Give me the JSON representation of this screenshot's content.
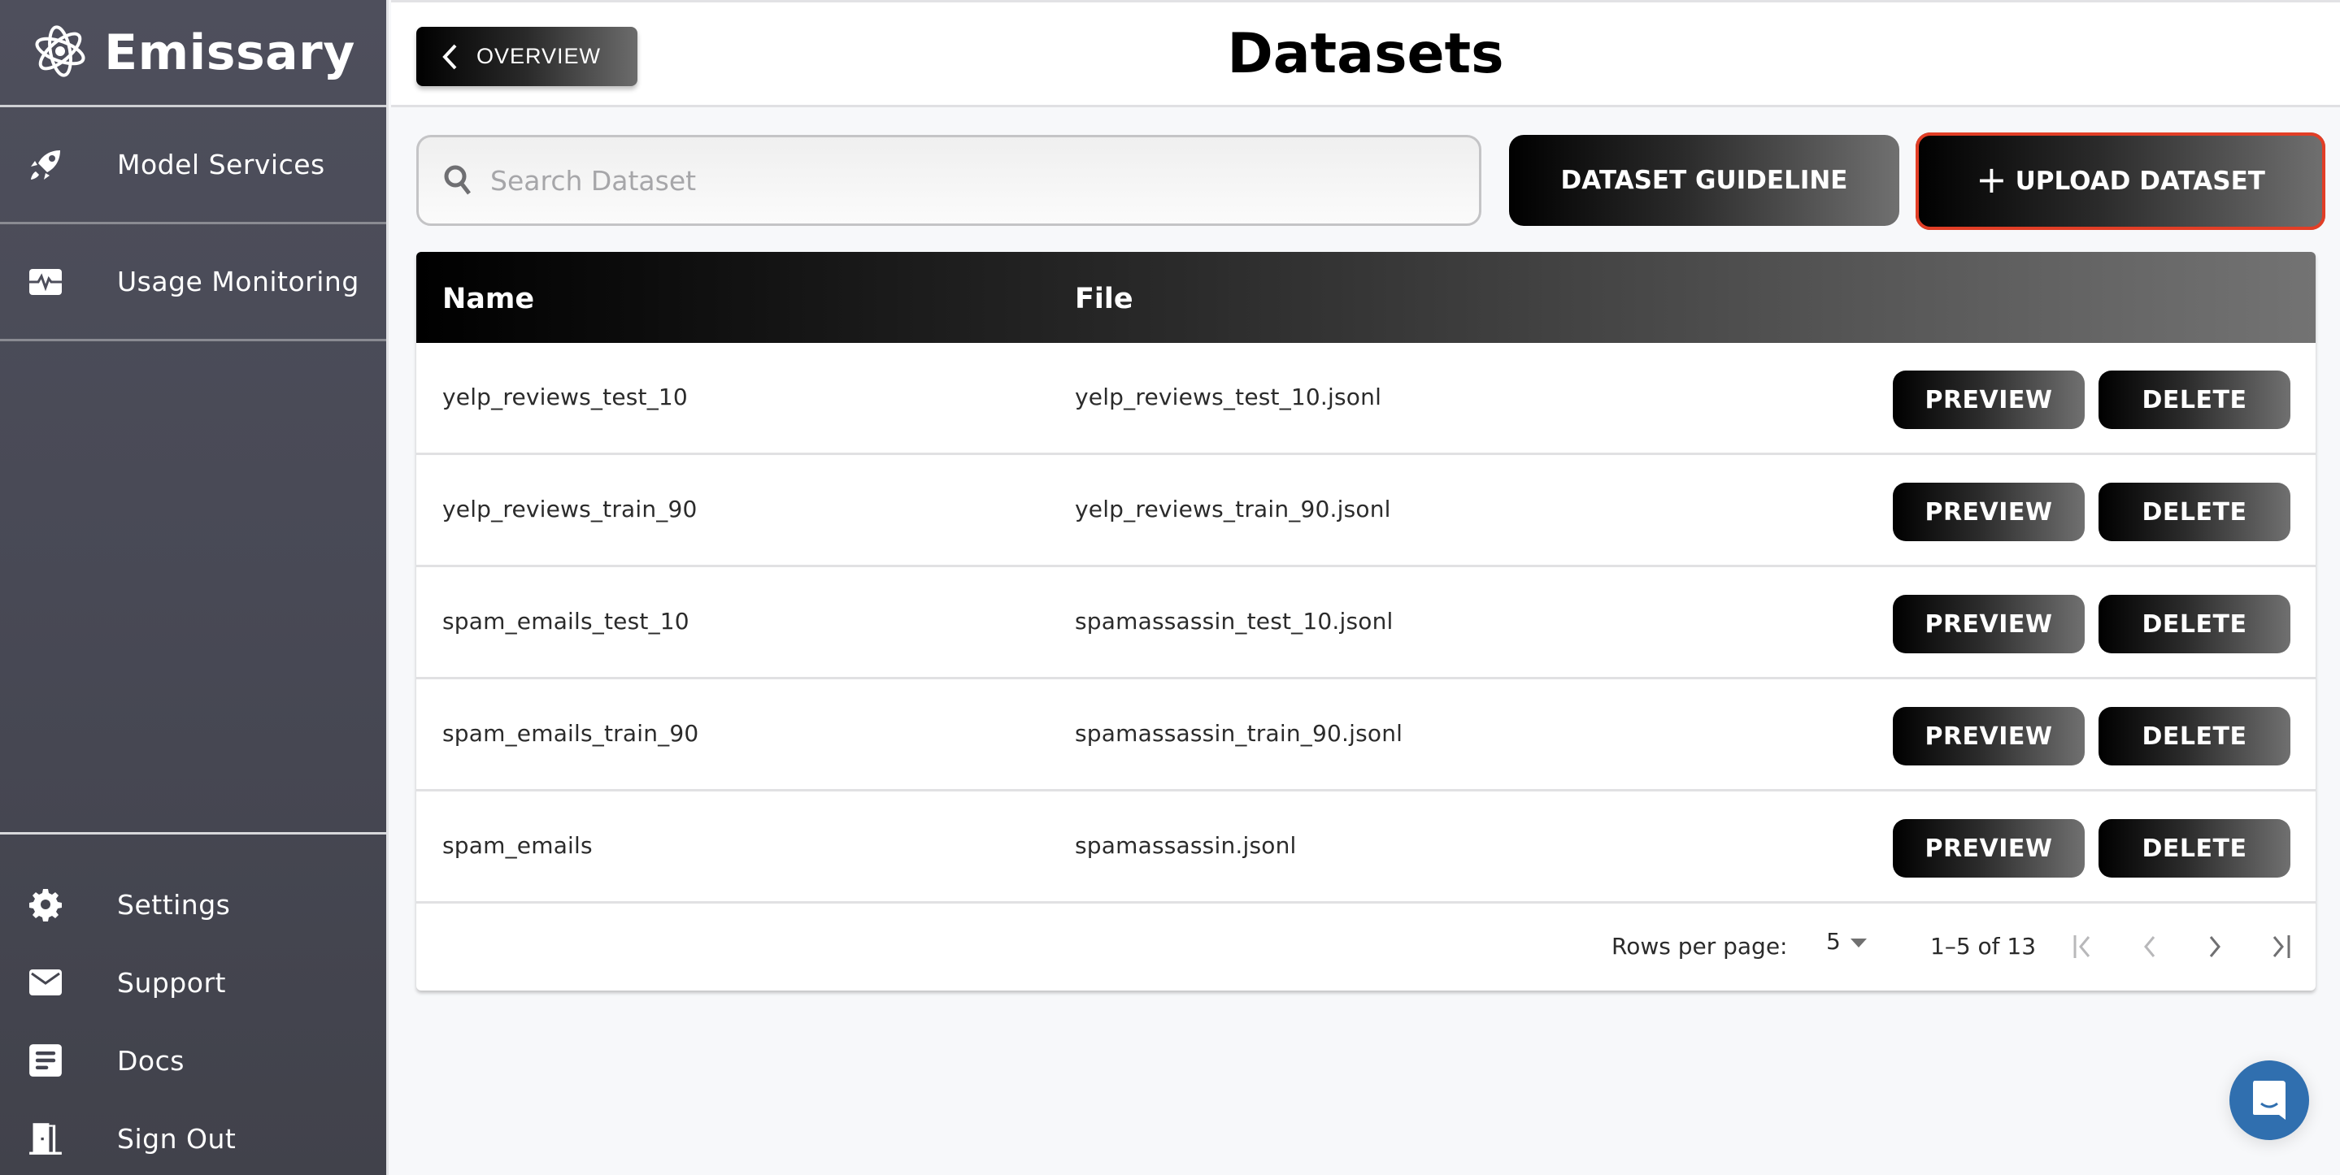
{
  "app": {
    "name": "Emissary"
  },
  "colors": {
    "sidebar_bg": "#4a4b57",
    "accent_border": "#e23e26",
    "chat_fab": "#306faf"
  },
  "sidebar": {
    "items": [
      {
        "label": "Model Services",
        "icon": "rocket-icon"
      },
      {
        "label": "Usage Monitoring",
        "icon": "activity-monitor-icon"
      }
    ],
    "bottom_items": [
      {
        "label": "Settings",
        "icon": "gear-icon"
      },
      {
        "label": "Support",
        "icon": "mail-icon"
      },
      {
        "label": "Docs",
        "icon": "document-icon"
      },
      {
        "label": "Sign Out",
        "icon": "door-icon"
      }
    ]
  },
  "header": {
    "back_label": "OVERVIEW",
    "title": "Datasets"
  },
  "toolbar": {
    "search_placeholder": "Search Dataset",
    "search_value": "",
    "guideline_label": "DATASET GUIDELINE",
    "upload_label": "UPLOAD DATASET",
    "upload_icon": "+"
  },
  "table": {
    "columns": [
      "Name",
      "File"
    ],
    "rows": [
      {
        "name": "yelp_reviews_test_10",
        "file": "yelp_reviews_test_10.jsonl"
      },
      {
        "name": "yelp_reviews_train_90",
        "file": "yelp_reviews_train_90.jsonl"
      },
      {
        "name": "spam_emails_test_10",
        "file": "spamassassin_test_10.jsonl"
      },
      {
        "name": "spam_emails_train_90",
        "file": "spamassassin_train_90.jsonl"
      },
      {
        "name": "spam_emails",
        "file": "spamassassin.jsonl"
      }
    ],
    "row_actions": {
      "preview": "PREVIEW",
      "delete": "DELETE"
    }
  },
  "pagination": {
    "rows_per_page_label": "Rows per page:",
    "rows_per_page": "5",
    "range": "1–5 of 13"
  }
}
